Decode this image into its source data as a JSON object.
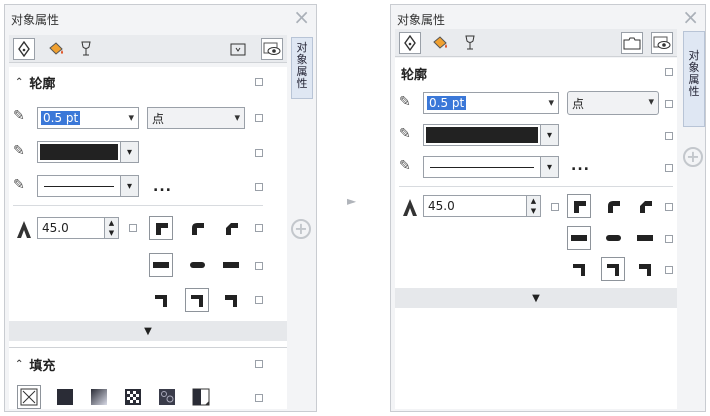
{
  "panel_title": "对象属性",
  "docker_tab": [
    "对",
    "象",
    "属",
    "性"
  ],
  "icons": {
    "close": "×",
    "collapse": "⌃",
    "expand_more": "▼",
    "dropdown": "▾",
    "spin_up": "▲",
    "spin_down": "▼",
    "plus": "+",
    "more": "..."
  },
  "outline": {
    "header": "轮廓",
    "width_value": "0.5 pt",
    "unit": "点",
    "color": "#222222",
    "miter_value": "45.0"
  },
  "fill": {
    "header": "填充"
  },
  "colors": {
    "selection": "#3b78d8",
    "panel_bg": "#f3f4f6",
    "tab_bg": "#dfe7f3"
  }
}
